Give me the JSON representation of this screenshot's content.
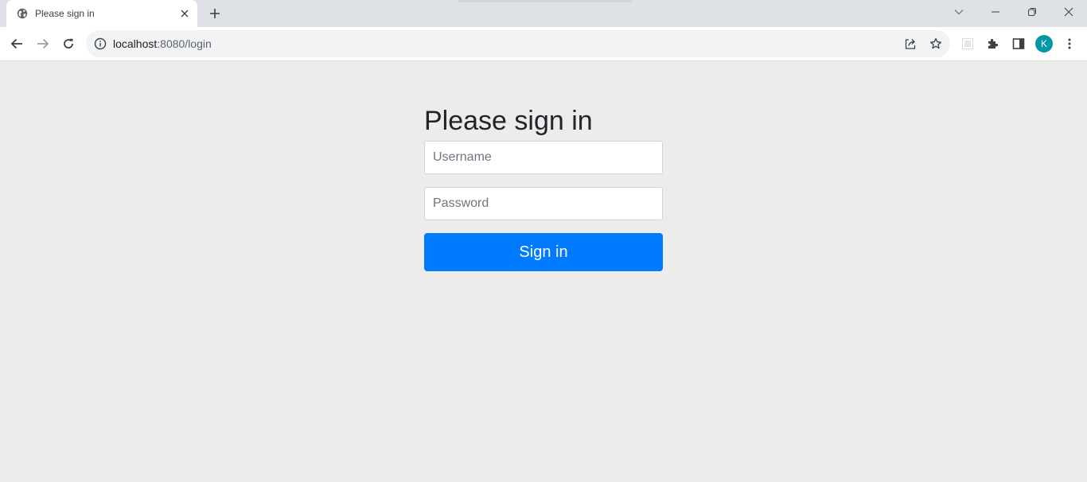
{
  "browser": {
    "tab": {
      "title": "Please sign in",
      "favicon": "globe-icon",
      "close_icon": "close-icon"
    },
    "new_tab_icon": "plus-icon",
    "window_controls": [
      "chevron-down-icon",
      "minimize-icon",
      "restore-icon",
      "close-icon"
    ],
    "toolbar": {
      "back_icon": "arrow-left-icon",
      "forward_icon": "arrow-right-icon",
      "reload_icon": "reload-icon",
      "site_info_icon": "info-icon",
      "url_host": "localhost",
      "url_rest": ":8080/login",
      "share_icon": "share-icon",
      "bookmark_icon": "star-icon",
      "extension_icons": [
        "extension-placeholder-icon",
        "puzzle-icon",
        "side-panel-icon"
      ],
      "profile_initial": "K",
      "menu_icon": "kebab-menu-icon"
    },
    "colors": {
      "tabstrip": "#dee1e6",
      "page_background": "#ececec",
      "primary_button": "#007bff",
      "avatar": "#0097a7"
    }
  },
  "login": {
    "heading": "Please sign in",
    "username_placeholder": "Username",
    "password_placeholder": "Password",
    "submit_label": "Sign in"
  }
}
